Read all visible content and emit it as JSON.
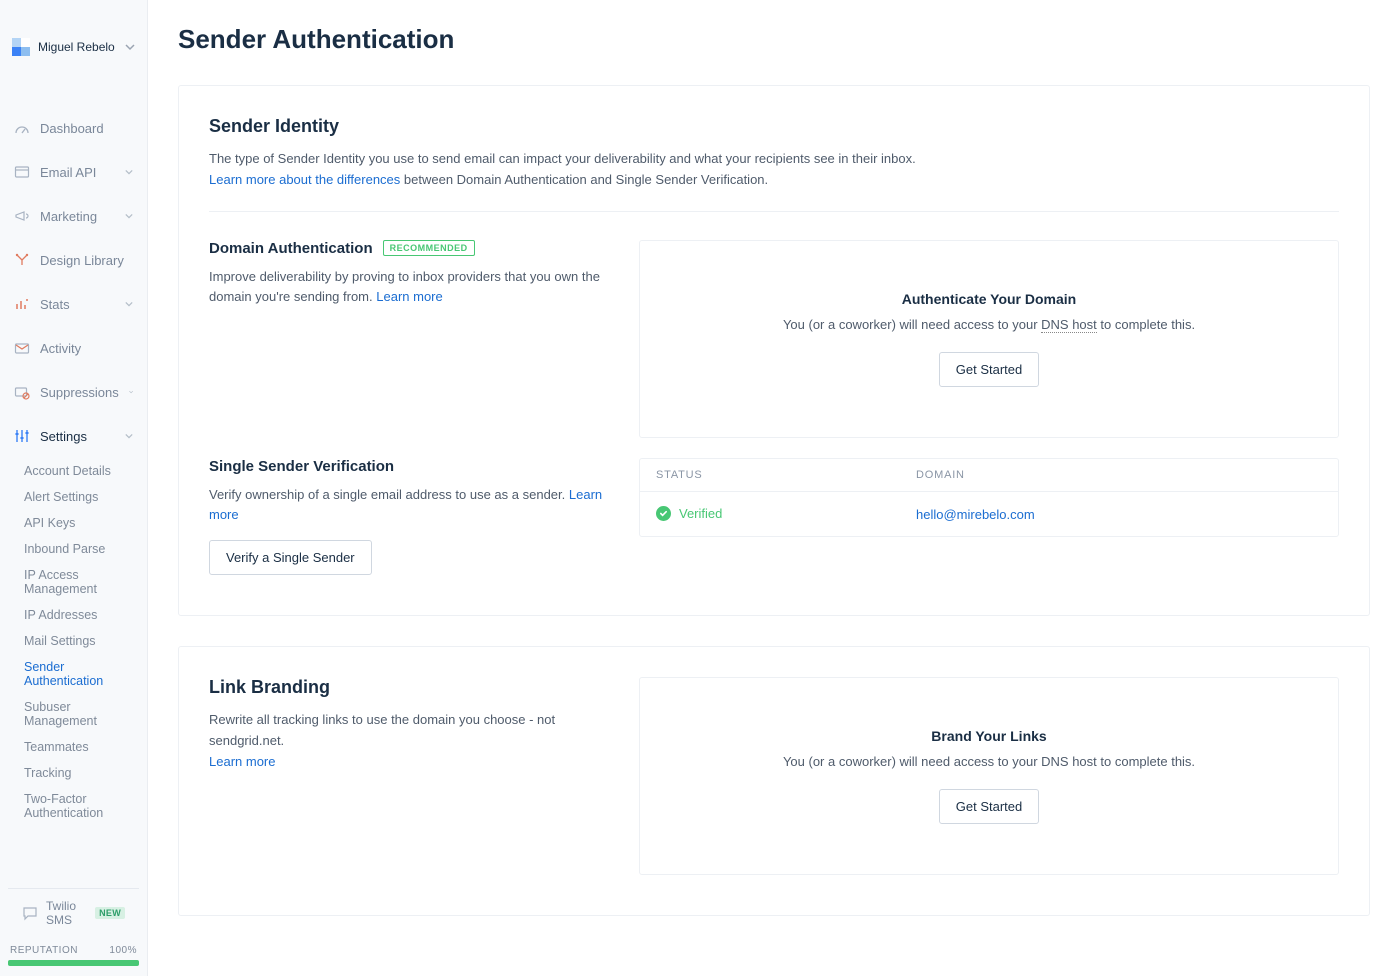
{
  "user": {
    "name": "Miguel Rebelo"
  },
  "nav": [
    {
      "label": "Dashboard"
    },
    {
      "label": "Email API",
      "expandable": true
    },
    {
      "label": "Marketing",
      "expandable": true
    },
    {
      "label": "Design Library"
    },
    {
      "label": "Stats",
      "expandable": true
    },
    {
      "label": "Activity"
    },
    {
      "label": "Suppressions",
      "expandable": true
    },
    {
      "label": "Settings",
      "expandable": true,
      "active": true
    }
  ],
  "settings_subnav": [
    "Account Details",
    "Alert Settings",
    "API Keys",
    "Inbound Parse",
    "IP Access Management",
    "IP Addresses",
    "Mail Settings",
    "Sender Authentication",
    "Subuser Management",
    "Teammates",
    "Tracking",
    "Two-Factor Authentication"
  ],
  "settings_active_index": 7,
  "sms": {
    "label": "Twilio SMS",
    "badge": "NEW"
  },
  "reputation": {
    "label": "REPUTATION",
    "value": "100%",
    "percent": 100
  },
  "page": {
    "title": "Sender Authentication"
  },
  "sender_identity": {
    "title": "Sender Identity",
    "desc_prefix": "The type of Sender Identity you use to send email can impact your deliverability and what your recipients see in their inbox.",
    "learn_link": "Learn more about the differences",
    "desc_suffix": " between Domain Authentication and Single Sender Verification."
  },
  "domain_auth": {
    "title": "Domain Authentication",
    "badge": "RECOMMENDED",
    "desc": "Improve deliverability by proving to inbox providers that you own the domain you're sending from. ",
    "learn": "Learn more",
    "cta_title": "Authenticate Your Domain",
    "cta_desc_pre": "You (or a coworker) will need access to your ",
    "cta_dns": "DNS host",
    "cta_desc_post": " to complete this.",
    "cta_btn": "Get Started"
  },
  "ssv": {
    "title": "Single Sender Verification",
    "desc": "Verify ownership of a single email address to use as a sender. ",
    "learn": "Learn more",
    "btn": "Verify a Single Sender",
    "cols": {
      "status": "STATUS",
      "domain": "DOMAIN"
    },
    "rows": [
      {
        "status": "Verified",
        "domain": "hello@mirebelo.com"
      }
    ]
  },
  "link_branding": {
    "title": "Link Branding",
    "desc": "Rewrite all tracking links to use the domain you choose - not sendgrid.net.",
    "learn": "Learn more",
    "cta_title": "Brand Your Links",
    "cta_desc": "You (or a coworker) will need access to your DNS host to complete this.",
    "cta_btn": "Get Started"
  }
}
